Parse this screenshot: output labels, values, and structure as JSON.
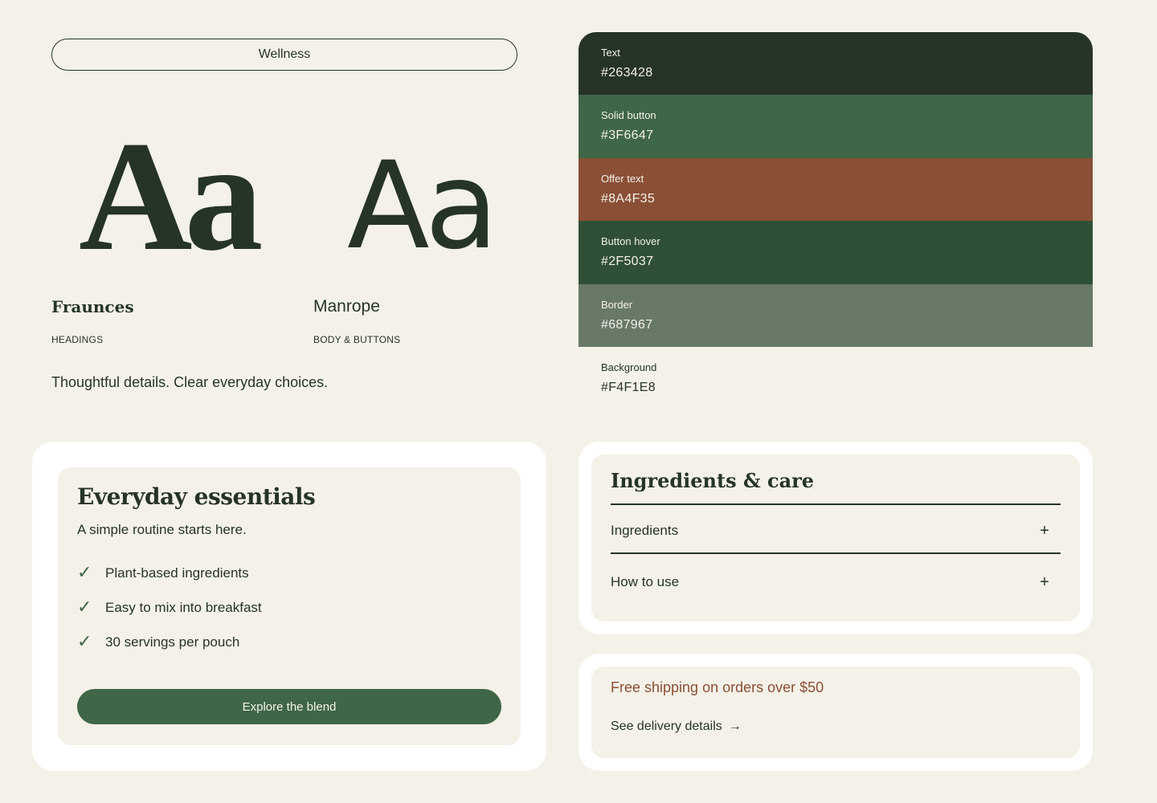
{
  "tag": {
    "label": "Wellness"
  },
  "typography": {
    "specimen": "Aa",
    "heading_font": {
      "name": "Fraunces",
      "role": "HEADINGS"
    },
    "body_font": {
      "name": "Manrope",
      "role": "BODY & BUTTONS"
    },
    "tagline": "Thoughtful details. Clear everyday choices."
  },
  "palette": [
    {
      "label": "Text",
      "hex": "#263428",
      "color": "#263428"
    },
    {
      "label": "Solid button",
      "hex": "#3F6647",
      "color": "#3F6647"
    },
    {
      "label": "Offer text",
      "hex": "#8A4F35",
      "color": "#8A4F35"
    },
    {
      "label": "Button hover",
      "hex": "#2F5037",
      "color": "#2F5037"
    },
    {
      "label": "Border",
      "hex": "#687967",
      "color": "#687967"
    },
    {
      "label": "Background",
      "hex": "#F4F1E8",
      "color": "#F4F1E8"
    }
  ],
  "essentials": {
    "title": "Everyday essentials",
    "subtitle": "A simple routine starts here.",
    "features": [
      "Plant-based ingredients",
      "Easy to mix into breakfast",
      "30 servings per pouch"
    ],
    "check_glyph": "✓",
    "cta_label": "Explore the blend"
  },
  "ingredients_care": {
    "title": "Ingredients & care",
    "items": [
      {
        "label": "Ingredients",
        "icon": "+"
      },
      {
        "label": "How to use",
        "icon": "+"
      }
    ]
  },
  "shipping": {
    "offer": "Free shipping on orders over $50",
    "link_label": "See delivery details",
    "link_arrow": "→"
  }
}
